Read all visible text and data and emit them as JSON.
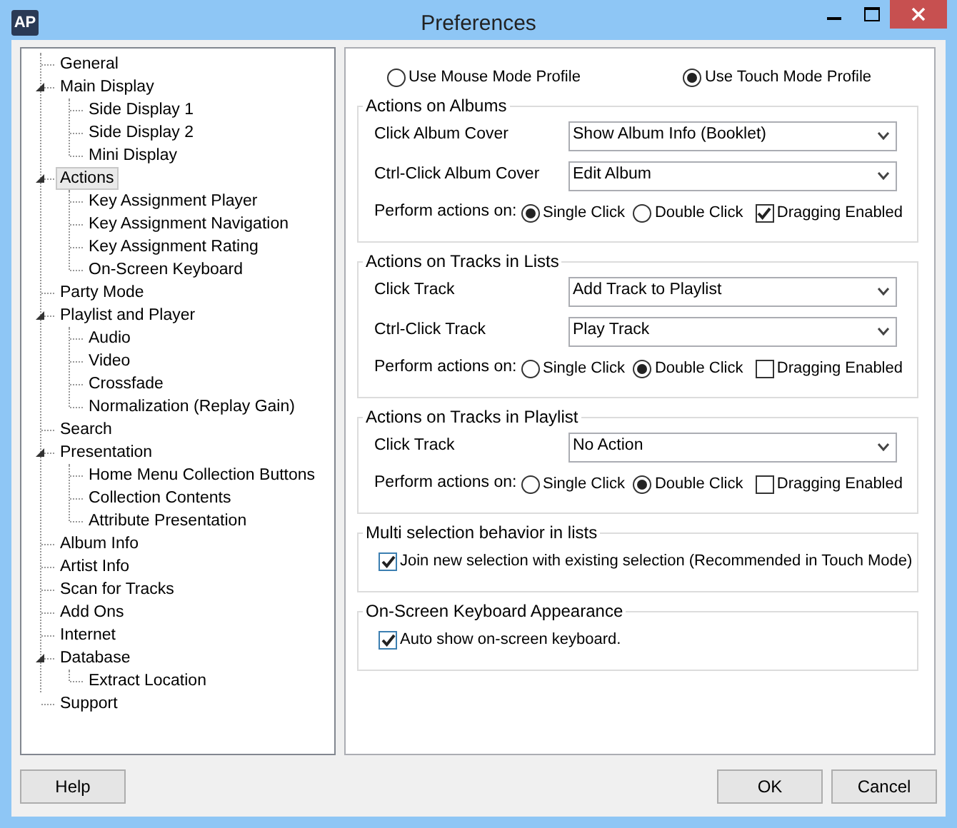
{
  "window": {
    "app_icon": "AP",
    "title": "Preferences"
  },
  "tree": [
    {
      "label": "General",
      "expanded": false,
      "selected": false
    },
    {
      "label": "Main Display",
      "expanded": true,
      "selected": false,
      "children": [
        {
          "label": "Side Display 1",
          "selected": false
        },
        {
          "label": "Side Display 2",
          "selected": false
        },
        {
          "label": "Mini Display",
          "selected": false
        }
      ]
    },
    {
      "label": "Actions",
      "expanded": true,
      "selected": true,
      "children": [
        {
          "label": "Key Assignment Player",
          "selected": false
        },
        {
          "label": "Key Assignment Navigation",
          "selected": false
        },
        {
          "label": "Key Assignment Rating",
          "selected": false
        },
        {
          "label": "On-Screen Keyboard",
          "selected": false
        }
      ]
    },
    {
      "label": "Party Mode",
      "expanded": false,
      "selected": false
    },
    {
      "label": "Playlist and Player",
      "expanded": true,
      "selected": false,
      "children": [
        {
          "label": "Audio",
          "selected": false
        },
        {
          "label": "Video",
          "selected": false
        },
        {
          "label": "Crossfade",
          "selected": false
        },
        {
          "label": "Normalization (Replay Gain)",
          "selected": false
        }
      ]
    },
    {
      "label": "Search",
      "expanded": false,
      "selected": false
    },
    {
      "label": "Presentation",
      "expanded": true,
      "selected": false,
      "children": [
        {
          "label": "Home Menu Collection Buttons",
          "selected": false
        },
        {
          "label": "Collection Contents",
          "selected": false
        },
        {
          "label": "Attribute Presentation",
          "selected": false
        }
      ]
    },
    {
      "label": "Album Info",
      "expanded": false,
      "selected": false
    },
    {
      "label": "Artist Info",
      "expanded": false,
      "selected": false
    },
    {
      "label": "Scan for Tracks",
      "expanded": false,
      "selected": false
    },
    {
      "label": "Add Ons",
      "expanded": false,
      "selected": false
    },
    {
      "label": "Internet",
      "expanded": false,
      "selected": false
    },
    {
      "label": "Database",
      "expanded": true,
      "selected": false,
      "children": [
        {
          "label": "Extract Location",
          "selected": false
        }
      ]
    },
    {
      "label": "Support",
      "expanded": false,
      "selected": false
    }
  ],
  "profiles": [
    {
      "label": "Use Mouse Mode Profile",
      "selected": false
    },
    {
      "label": "Use Touch Mode Profile",
      "selected": true
    }
  ],
  "groups": [
    {
      "title": "Actions on Albums",
      "rows": [
        {
          "kind": "select",
          "label": "Click Album Cover",
          "value": "Show Album Info (Booklet)"
        },
        {
          "kind": "select",
          "label": "Ctrl-Click Album Cover",
          "value": "Edit Album"
        },
        {
          "kind": "actions",
          "label": "Perform actions on:",
          "options": [
            {
              "label": "Single Click",
              "selected": true
            },
            {
              "label": "Double Click",
              "selected": false
            }
          ],
          "dragging": {
            "label": "Dragging Enabled",
            "checked": true
          }
        }
      ]
    },
    {
      "title": "Actions on Tracks in Lists",
      "rows": [
        {
          "kind": "select",
          "label": "Click Track",
          "value": "Add Track to Playlist"
        },
        {
          "kind": "select",
          "label": "Ctrl-Click Track",
          "value": "Play Track"
        },
        {
          "kind": "actions",
          "label": "Perform actions on:",
          "options": [
            {
              "label": "Single Click",
              "selected": false
            },
            {
              "label": "Double Click",
              "selected": true
            }
          ],
          "dragging": {
            "label": "Dragging Enabled",
            "checked": false
          }
        }
      ]
    },
    {
      "title": "Actions on Tracks in Playlist",
      "rows": [
        {
          "kind": "select",
          "label": "Click Track",
          "value": "No Action"
        },
        {
          "kind": "actions",
          "label": "Perform actions on:",
          "options": [
            {
              "label": "Single Click",
              "selected": false
            },
            {
              "label": "Double Click",
              "selected": true
            }
          ],
          "dragging": {
            "label": "Dragging Enabled",
            "checked": false
          }
        }
      ]
    },
    {
      "title": "Multi selection behavior in lists",
      "rows": [
        {
          "kind": "checkbox",
          "label": "Join new selection with existing selection (Recommended in Touch Mode)",
          "checked": true
        }
      ]
    },
    {
      "title": "On-Screen Keyboard Appearance",
      "rows": [
        {
          "kind": "checkbox",
          "label": "Auto show on-screen keyboard.",
          "checked": true
        }
      ]
    }
  ],
  "buttons": {
    "left": [
      "Help"
    ],
    "right": [
      "OK",
      "Cancel"
    ]
  }
}
